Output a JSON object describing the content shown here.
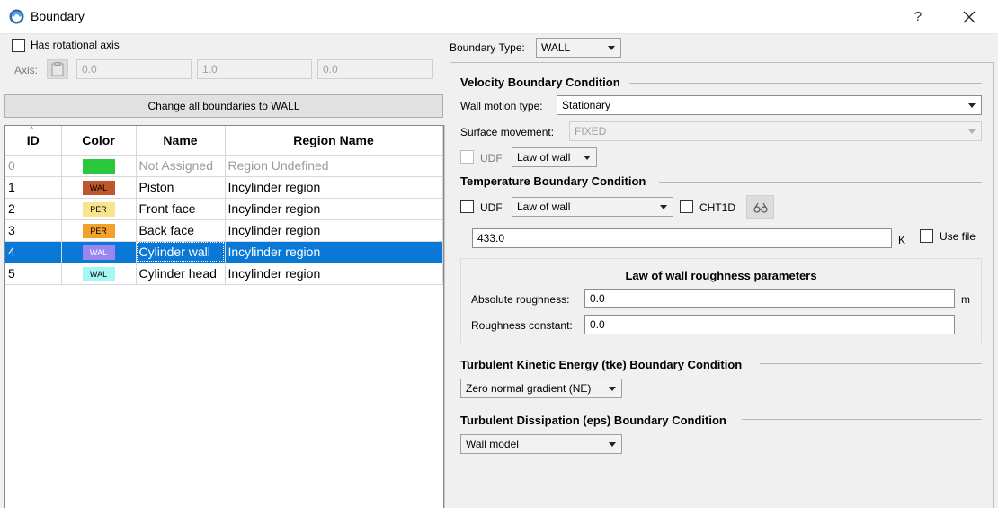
{
  "window": {
    "title": "Boundary",
    "help": "?"
  },
  "axis": {
    "has_rotational_label": "Has rotational axis",
    "axis_label": "Axis:",
    "x": "0.0",
    "y": "1.0",
    "z": "0.0"
  },
  "change_all_button": "Change all boundaries to WALL",
  "table": {
    "columns": [
      "ID",
      "Color",
      "Name",
      "Region Name"
    ],
    "rows": [
      {
        "id": "0",
        "swatch_label": "",
        "swatch_color": "#28c93c",
        "name": "Not Assigned",
        "region": "Region Undefined"
      },
      {
        "id": "1",
        "swatch_label": "WAL",
        "swatch_color": "#c0562b",
        "name": "Piston",
        "region": "Incylinder region"
      },
      {
        "id": "2",
        "swatch_label": "PER",
        "swatch_color": "#f7e48c",
        "name": "Front face",
        "region": "Incylinder region"
      },
      {
        "id": "3",
        "swatch_label": "PER",
        "swatch_color": "#f4a12a",
        "name": "Back face",
        "region": "Incylinder region"
      },
      {
        "id": "4",
        "swatch_label": "WAL",
        "swatch_color": "#9a86ee",
        "name": "Cylinder wall",
        "region": "Incylinder region"
      },
      {
        "id": "5",
        "swatch_label": "WAL",
        "swatch_color": "#a6f6f4",
        "name": "Cylinder head",
        "region": "Incylinder region"
      }
    ]
  },
  "boundary_type": {
    "label": "Boundary Type:",
    "value": "WALL"
  },
  "velocity": {
    "title": "Velocity Boundary Condition",
    "wall_motion_label": "Wall motion type:",
    "wall_motion_value": "Stationary",
    "surface_movement_label": "Surface movement:",
    "surface_movement_value": "FIXED",
    "udf_label": "UDF",
    "law_value": "Law of wall"
  },
  "temperature": {
    "title": "Temperature Boundary Condition",
    "udf_label": "UDF",
    "law_value": "Law of wall",
    "cht1d_label": "CHT1D",
    "value": "433.0",
    "unit": "K",
    "use_file_label": "Use file"
  },
  "roughness": {
    "title": "Law of wall roughness parameters",
    "absolute_label": "Absolute roughness:",
    "absolute_value": "0.0",
    "absolute_unit": "m",
    "constant_label": "Roughness constant:",
    "constant_value": "0.0"
  },
  "tke": {
    "title": "Turbulent Kinetic Energy (tke) Boundary Condition",
    "value": "Zero normal gradient (NE)"
  },
  "eps": {
    "title": "Turbulent Dissipation (eps) Boundary Condition",
    "value": "Wall model"
  },
  "colors": {
    "selection": "#0a78d7",
    "app_icon": "#2b6cb5"
  }
}
